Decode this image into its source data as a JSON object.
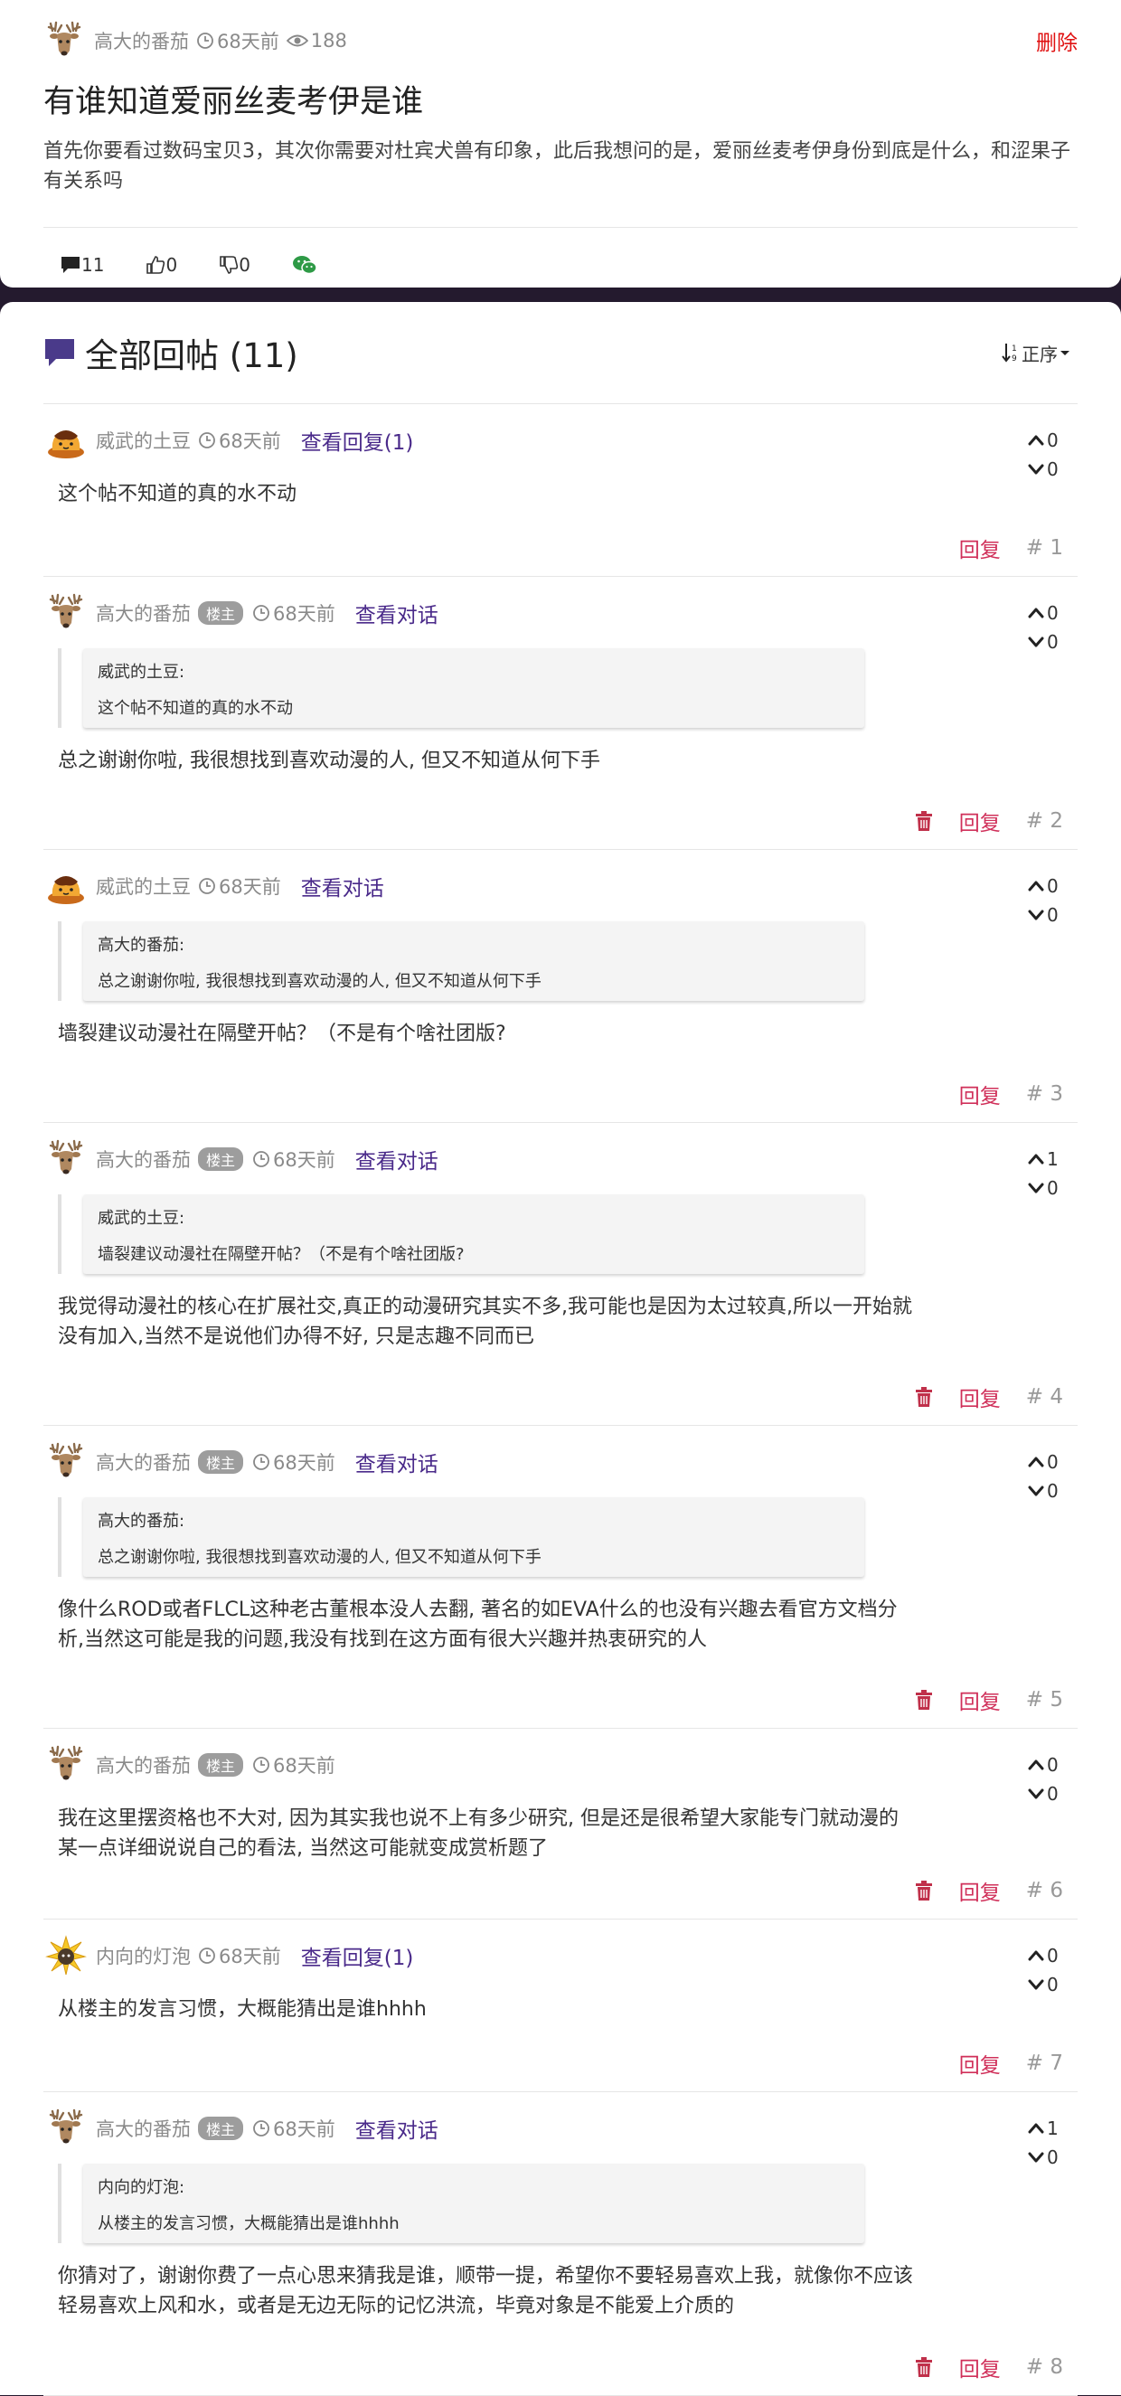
{
  "post": {
    "author": "高大的番茄",
    "time": "68天前",
    "views": "188",
    "delete_label": "删除",
    "title": "有谁知道爱丽丝麦考伊是谁",
    "body": "首先你要看过数码宝贝3，其次你需要对杜宾犬兽有印象，此后我想问的是，爱丽丝麦考伊身份到底是什么，和涩果子有关系吗",
    "comments": "11",
    "likes": "0",
    "dislikes": "0"
  },
  "replies_section": {
    "title": "全部回帖 (11)",
    "sort_label": "正序"
  },
  "labels": {
    "reply": "回复",
    "op_badge": "楼主"
  },
  "colors": {
    "page_bg": "#241a2e",
    "accent_purple": "#4a3a8a",
    "delete_red": "#e01010",
    "reply_pink": "#d0305a"
  },
  "replies": [
    {
      "author": "威武的土豆",
      "avatar": "pudding-avatar",
      "op": false,
      "time": "68天前",
      "link": "查看回复(1)",
      "up": "0",
      "down": "0",
      "body": "这个帖不知道的真的水不动",
      "floor": "# 1",
      "deletable": false
    },
    {
      "author": "高大的番茄",
      "avatar": "deer-avatar",
      "op": true,
      "time": "68天前",
      "link": "查看对话",
      "up": "0",
      "down": "0",
      "quote_author": "威武的土豆:",
      "quote_text": "这个帖不知道的真的水不动",
      "body": "总之谢谢你啦, 我很想找到喜欢动漫的人, 但又不知道从何下手",
      "floor": "# 2",
      "deletable": true
    },
    {
      "author": "威武的土豆",
      "avatar": "pudding-avatar",
      "op": false,
      "time": "68天前",
      "link": "查看对话",
      "up": "0",
      "down": "0",
      "quote_author": "高大的番茄:",
      "quote_text": "总之谢谢你啦, 我很想找到喜欢动漫的人, 但又不知道从何下手",
      "body": "墙裂建议动漫社在隔壁开帖？（不是有个啥社团版?",
      "floor": "# 3",
      "deletable": false
    },
    {
      "author": "高大的番茄",
      "avatar": "deer-avatar",
      "op": true,
      "time": "68天前",
      "link": "查看对话",
      "up": "1",
      "down": "0",
      "quote_author": "威武的土豆:",
      "quote_text": "墙裂建议动漫社在隔壁开帖？（不是有个啥社团版?",
      "body": "我觉得动漫社的核心在扩展社交,真正的动漫研究其实不多,我可能也是因为太过较真,所以一开始就没有加入,当然不是说他们办得不好, 只是志趣不同而已",
      "floor": "# 4",
      "deletable": true
    },
    {
      "author": "高大的番茄",
      "avatar": "deer-avatar",
      "op": true,
      "time": "68天前",
      "link": "查看对话",
      "up": "0",
      "down": "0",
      "quote_author": "高大的番茄:",
      "quote_text": "总之谢谢你啦, 我很想找到喜欢动漫的人, 但又不知道从何下手",
      "body": "像什么ROD或者FLCL这种老古董根本没人去翻, 著名的如EVA什么的也没有兴趣去看官方文档分析,当然这可能是我的问题,我没有找到在这方面有很大兴趣并热衷研究的人",
      "floor": "# 5",
      "deletable": true
    },
    {
      "author": "高大的番茄",
      "avatar": "deer-avatar",
      "op": true,
      "time": "68天前",
      "link": "",
      "up": "0",
      "down": "0",
      "body": "我在这里摆资格也不大对, 因为其实我也说不上有多少研究, 但是还是很希望大家能专门就动漫的某一点详细说说自己的看法, 当然这可能就变成赏析题了",
      "floor": "# 6",
      "deletable": true
    },
    {
      "author": "内向的灯泡",
      "avatar": "bulb-avatar",
      "op": false,
      "time": "68天前",
      "link": "查看回复(1)",
      "up": "0",
      "down": "0",
      "body": "从楼主的发言习惯，大概能猜出是谁hhhh",
      "floor": "# 7",
      "deletable": false
    },
    {
      "author": "高大的番茄",
      "avatar": "deer-avatar",
      "op": true,
      "time": "68天前",
      "link": "查看对话",
      "up": "1",
      "down": "0",
      "quote_author": "内向的灯泡:",
      "quote_text": "从楼主的发言习惯，大概能猜出是谁hhhh",
      "body": "你猜对了，谢谢你费了一点心思来猜我是谁，顺带一提，希望你不要轻易喜欢上我，就像你不应该轻易喜欢上风和水，或者是无边无际的记忆洪流，毕竟对象是不能爱上介质的",
      "floor": "# 8",
      "deletable": true
    }
  ]
}
